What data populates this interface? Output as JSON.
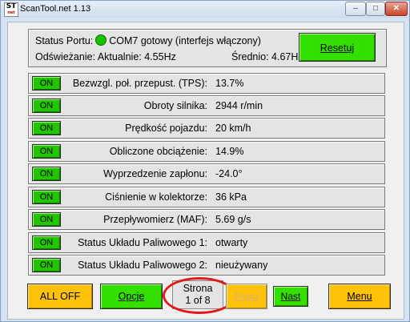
{
  "window": {
    "title": "ScanTool.net 1.13",
    "icon_text_top": "ST",
    "icon_text_bottom": "net",
    "minimize_glyph": "–",
    "maximize_glyph": "□",
    "close_glyph": "✕"
  },
  "status": {
    "port_label": "Status Portu:",
    "port_status_color": "#17c100",
    "port_text": "COM7 gotowy (interfejs włączony)",
    "refresh_label": "Odświeżanie:",
    "current_label": "Aktualnie:",
    "current_value": "4.55Hz",
    "average_label": "Średnio:",
    "average_value": "4.67Hz",
    "reset_label": "Resetuj"
  },
  "sensors": [
    {
      "toggle": "ON",
      "label": "Bezwzgl. poł. przepust. (TPS):",
      "value": "13.7%"
    },
    {
      "toggle": "ON",
      "label": "Obroty silnika:",
      "value": "2944 r/min"
    },
    {
      "toggle": "ON",
      "label": "Prędkość pojazdu:",
      "value": "20 km/h"
    },
    {
      "toggle": "ON",
      "label": "Obliczone obciążenie:",
      "value": "14.9%"
    },
    {
      "toggle": "ON",
      "label": "Wyprzedzenie zapłonu:",
      "value": "-24.0°"
    },
    {
      "toggle": "ON",
      "label": "Ciśnienie w kolektorze:",
      "value": "36 kPa"
    },
    {
      "toggle": "ON",
      "label": "Przepływomierz (MAF):",
      "value": "5.69 g/s"
    },
    {
      "toggle": "ON",
      "label": "Status Układu Paliwowego 1:",
      "value": "otwarty"
    },
    {
      "toggle": "ON",
      "label": "Status Układu Paliwowego 2:",
      "value": "nieużywany"
    }
  ],
  "footer": {
    "all_off_label": "ALL OFF",
    "options_label": "Opcje",
    "page_label": "Strona",
    "page_position": "1 of 8",
    "prev_label": "Poprz",
    "next_label": "Nast",
    "menu_label": "Menu"
  },
  "colors": {
    "green_button": "#33e000",
    "yellow_button": "#ffc20a",
    "highlight_ring": "#e0191b"
  }
}
